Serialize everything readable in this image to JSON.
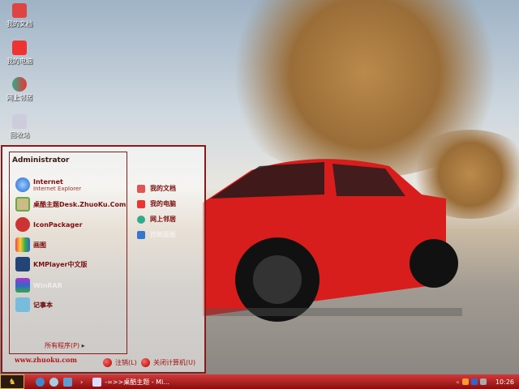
{
  "desktop": {
    "icons": [
      {
        "label": "我的文档",
        "icon": "my-documents-icon"
      },
      {
        "label": "我的电脑",
        "icon": "my-computer-icon"
      },
      {
        "label": "网上邻居",
        "icon": "network-icon"
      },
      {
        "label": "回收站",
        "icon": "recycle-bin-icon"
      }
    ]
  },
  "start_menu": {
    "user": "Administrator",
    "pinned": [
      {
        "label": "Internet",
        "sub": "Internet Explorer",
        "icon": "ie-icon"
      },
      {
        "label": "桌酷主题Desk.ZhuoKu.Com",
        "icon": "zhuoku-icon"
      },
      {
        "label": "IconPackager",
        "icon": "iconpackager-icon"
      },
      {
        "label": "画图",
        "icon": "paint-icon"
      },
      {
        "label": "KMPlayer中文版",
        "icon": "kmplayer-icon"
      },
      {
        "label": "WinRAR",
        "icon": "winrar-icon"
      },
      {
        "label": "记事本",
        "icon": "notepad-icon"
      }
    ],
    "places": [
      {
        "label": "我的文档",
        "icon": "my-documents-icon"
      },
      {
        "label": "我的电脑",
        "icon": "my-computer-icon"
      },
      {
        "label": "网上邻居",
        "icon": "network-icon"
      },
      {
        "label": "控制面板",
        "icon": "control-panel-icon"
      }
    ],
    "all_programs": "所有程序(P)",
    "website": "www.zhuoku.com",
    "logoff": "注销(L)",
    "shutdown": "关闭计算机(U)"
  },
  "taskbar": {
    "window": "-=>>桌酷主题 - Mi...",
    "clock": "10:26",
    "accent": "#b01818"
  }
}
